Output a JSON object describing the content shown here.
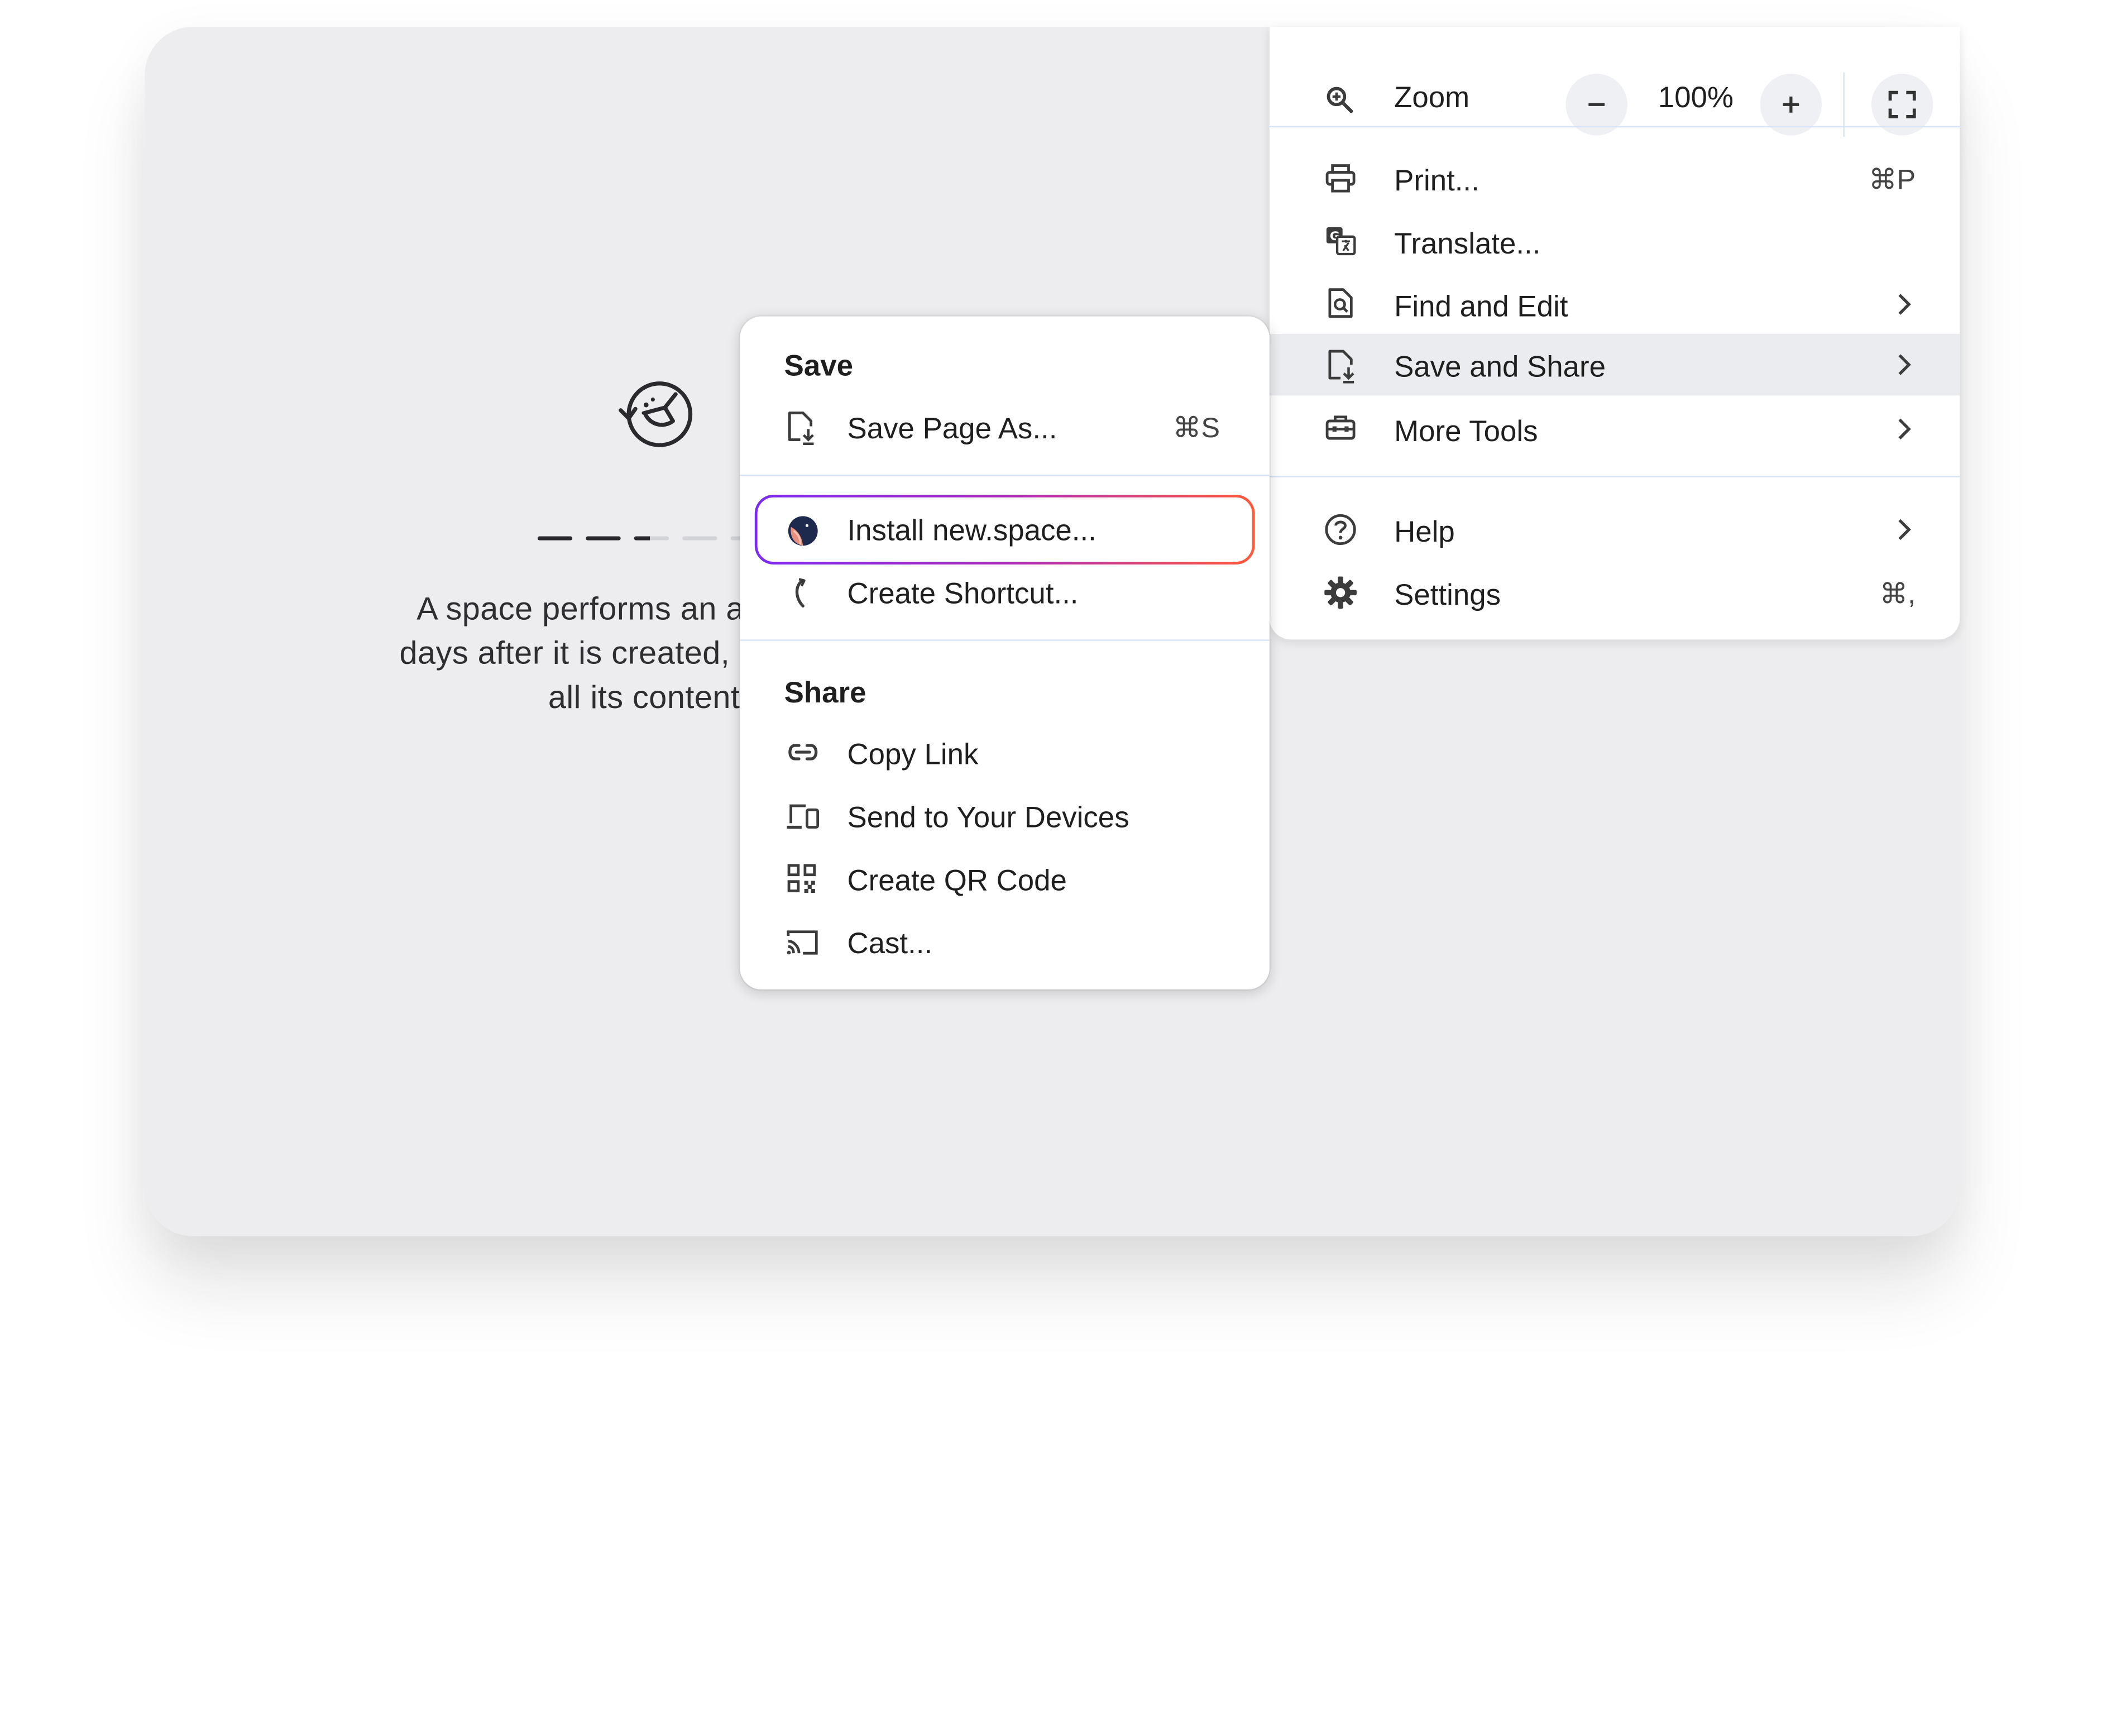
{
  "page": {
    "progress_step": 3,
    "progress_total": 5,
    "description": "A space performs an auto-cleanup days after it is created, deleting itself and all its contents.",
    "description_lines": [
      "A space performs an auto-cleanu",
      "days after it is created, deleting itse",
      "all its contents."
    ]
  },
  "menu": {
    "zoom": {
      "label": "Zoom",
      "minus": "−",
      "value": "100%",
      "plus": "+",
      "icon": "zoom-icon"
    },
    "items": [
      {
        "label": "Print...",
        "shortcut": "⌘P",
        "icon": "printer-icon"
      },
      {
        "label": "Translate...",
        "shortcut": "",
        "icon": "translate-icon"
      },
      {
        "label": "Find and Edit",
        "shortcut": "",
        "icon": "find-icon",
        "submenu": true
      },
      {
        "label": "Save and Share",
        "shortcut": "",
        "icon": "save-share-icon",
        "submenu": true,
        "active": true
      },
      {
        "label": "More Tools",
        "shortcut": "",
        "icon": "toolbox-icon",
        "submenu": true
      }
    ],
    "items2": [
      {
        "label": "Help",
        "shortcut": "",
        "icon": "help-icon",
        "submenu": true
      },
      {
        "label": "Settings",
        "shortcut": "⌘,",
        "icon": "gear-icon"
      }
    ]
  },
  "submenu": {
    "save_heading": "Save",
    "save_items": [
      {
        "label": "Save Page As...",
        "shortcut": "⌘S",
        "icon": "save-page-icon"
      }
    ],
    "install_items": [
      {
        "label": "Install new.space...",
        "icon": "new-space-logo-icon",
        "highlighted": true
      },
      {
        "label": "Create Shortcut...",
        "icon": "shortcut-icon"
      }
    ],
    "share_heading": "Share",
    "share_items": [
      {
        "label": "Copy Link",
        "icon": "link-icon"
      },
      {
        "label": "Send to Your Devices",
        "icon": "devices-icon"
      },
      {
        "label": "Create QR Code",
        "icon": "qr-code-icon"
      },
      {
        "label": "Cast...",
        "icon": "cast-icon"
      }
    ]
  },
  "colors": {
    "window_bg": "#ededef",
    "menu_bg": "#ffffff",
    "active_row": "#ebecef",
    "separator": "#d7e3f6",
    "highlight_gradient_start": "#7b2bf0",
    "highlight_gradient_end": "#ff5a3a"
  }
}
